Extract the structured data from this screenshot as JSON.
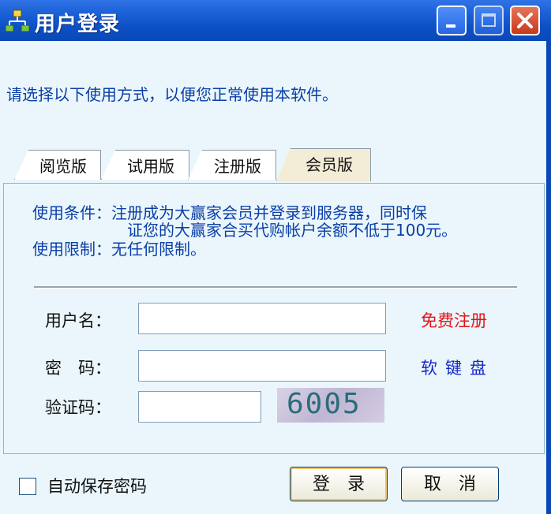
{
  "window": {
    "title": "用户登录",
    "icon": "network-tree-icon"
  },
  "instruction": "请选择以下使用方式，以便您正常使用本软件。",
  "tabs": [
    {
      "label": "阅览版",
      "active": false
    },
    {
      "label": "试用版",
      "active": false
    },
    {
      "label": "注册版",
      "active": false
    },
    {
      "label": "会员版",
      "active": true
    }
  ],
  "panel": {
    "condition_line1": "使用条件：注册成为大赢家会员并登录到服务器，同时保",
    "condition_line2": "证您的大赢家合买代购帐户余额不低于100元。",
    "restriction": "使用限制：无任何限制。"
  },
  "form": {
    "username_label": "用户名：",
    "username_value": "",
    "password_label": "密　码：",
    "password_value": "",
    "captcha_label": "验证码：",
    "captcha_value": "",
    "captcha_image_text": "6005",
    "register_link": "免费注册",
    "soft_keyboard_link": "软键盘"
  },
  "footer": {
    "remember_label": "自动保存密码",
    "remember_checked": false,
    "login_button": "登　录",
    "cancel_button": "取　消"
  },
  "colors": {
    "title_bar": "#0a48b7",
    "instruction_text": "#0a3ea8",
    "register_link": "#e4141b",
    "keyboard_link": "#1726c8"
  }
}
